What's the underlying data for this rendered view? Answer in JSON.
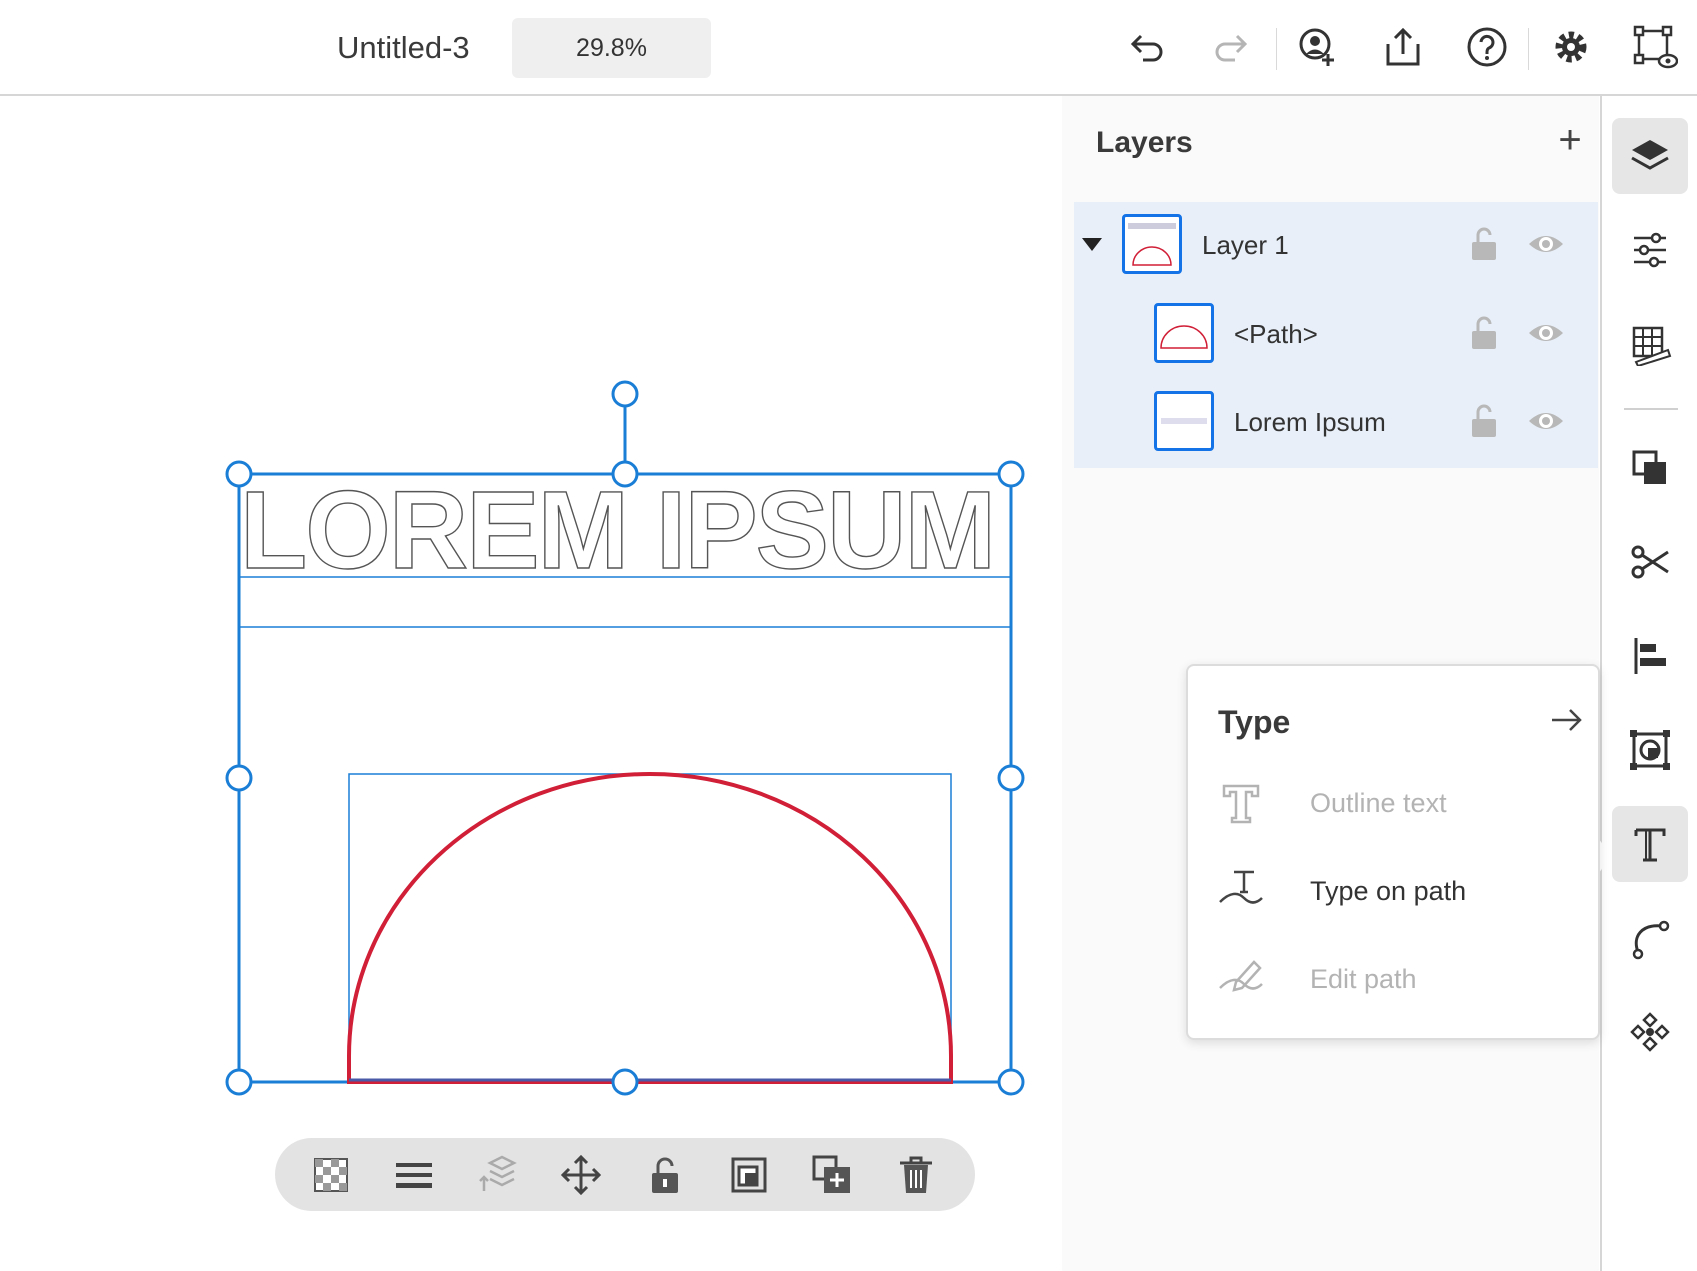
{
  "header": {
    "doc_title": "Untitled-3",
    "zoom": "29.8%",
    "icons": [
      "undo-icon",
      "redo-icon",
      "invite-icon",
      "share-icon",
      "help-icon",
      "settings-icon",
      "preview-icon"
    ]
  },
  "canvas": {
    "artboard_text": "LOREM IPSUM",
    "selection_color": "#1a7ed6",
    "path_color": "#d01f37",
    "bottom_toolbar_icons": [
      "transparency-icon",
      "align-lines-icon",
      "arrange-icon",
      "move-icon",
      "unlock-icon",
      "mask-icon",
      "duplicate-icon",
      "delete-icon"
    ]
  },
  "layers": {
    "title": "Layers",
    "add_label": "+",
    "items": [
      {
        "name": "Layer 1"
      },
      {
        "name": "<Path>"
      },
      {
        "name": "Lorem Ipsum"
      }
    ]
  },
  "rail": {
    "icons": [
      "layers-icon",
      "properties-icon",
      "grid-icon",
      "combine-icon",
      "cut-icon",
      "align-icon",
      "mask-icon",
      "type-icon",
      "pen-icon",
      "repeat-icon"
    ],
    "active": "type-icon"
  },
  "type_menu": {
    "title": "Type",
    "items": [
      {
        "label": "Outline text",
        "enabled": false
      },
      {
        "label": "Type on path",
        "enabled": true,
        "highlighted": true
      },
      {
        "label": "Edit path",
        "enabled": false
      }
    ]
  },
  "colors": {
    "accent": "#1473e6",
    "highlight": "#f6e98c",
    "layer_selection_bg": "#e8eff8"
  }
}
